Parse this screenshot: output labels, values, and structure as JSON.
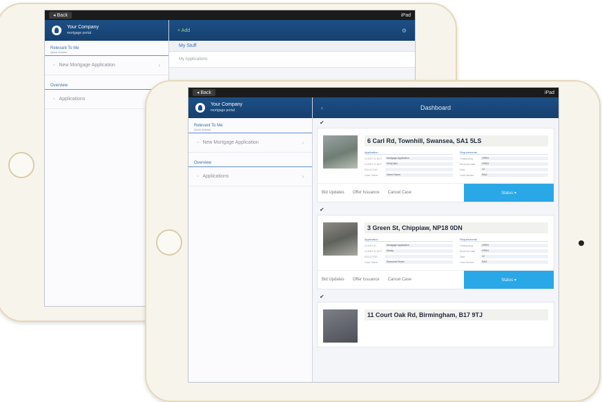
{
  "status_bar": {
    "back": "◂ Back",
    "device": "iPad"
  },
  "sidebar": {
    "brand_line1": "Your Company",
    "brand_line2": "mortgage portal",
    "section1_label": "Relevant To Me",
    "section1_sub": "Quick Actions",
    "item1": "New Mortgage Application",
    "section2_label": "Overview",
    "item2": "Applications"
  },
  "back_screen": {
    "add_label": "+ Add",
    "my_build": "My Stuff",
    "my_apps": "My Applications"
  },
  "dashboard": {
    "title": "Dashboard",
    "cards": [
      {
        "address": "6 Carl Rd, Townhill, Swansea, SA1 5LS",
        "col1_h": "Application",
        "col2_h": "Requirements",
        "r1k": "CLIENT ID NOT",
        "r1v": "Mortgage Application",
        "r2k": "CLIENT ID NOT",
        "r2v": "PENDING",
        "r3k": "SOLICITOR",
        "r3v": "",
        "r4k": "Case Owner",
        "r4v": "Client Owner",
        "q1k": "Outstanding",
        "q1v": "OPEN",
        "q2k": "Received date",
        "q2v": "OPEN",
        "q3k": "Date",
        "q3v": "12",
        "q4k": "Case Advisor",
        "q4v": "RAG",
        "a1": "Bid Updates",
        "a2": "Offer Issuance",
        "a3": "Cancel Case",
        "status": "Status ▾"
      },
      {
        "address": "3 Green St, Chippiaw, NP18 0DN",
        "col1_h": "Application",
        "col2_h": "Requirements",
        "r1k": "CLIENT ID",
        "r1v": "Mortgage Application",
        "r2k": "CLIENT ID NOT",
        "r2v": "Ready",
        "r3k": "SOLICITOR",
        "r3v": "",
        "r4k": "Case Owner",
        "r4v": "Seasonal Owner",
        "q1k": "Outstanding",
        "q1v": "OPEN",
        "q2k": "Received date",
        "q2v": "OPEN",
        "q3k": "Date",
        "q3v": "12",
        "q4k": "Case Advisor",
        "q4v": "RAG",
        "a1": "Bid Updates",
        "a2": "Offer Issuance",
        "a3": "Cancel Case",
        "status": "Status ▾"
      },
      {
        "address": "11 Court Oak Rd, Birmingham, B17 9TJ"
      }
    ]
  }
}
